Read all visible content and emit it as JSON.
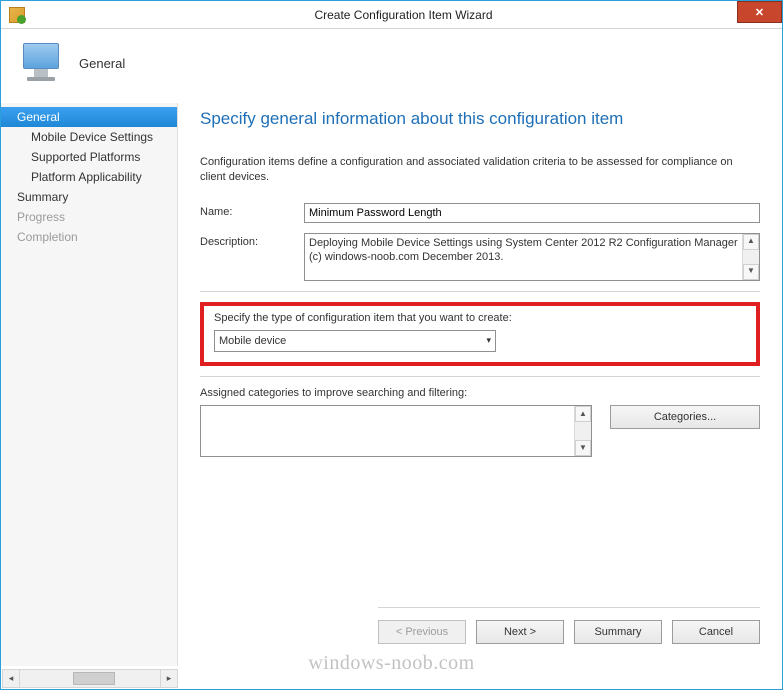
{
  "window": {
    "title": "Create Configuration Item Wizard",
    "close_symbol": "✕"
  },
  "header": {
    "title": "General"
  },
  "sidebar": {
    "items": [
      {
        "label": "General",
        "selected": true,
        "sub": false,
        "disabled": false
      },
      {
        "label": "Mobile Device Settings",
        "selected": false,
        "sub": true,
        "disabled": false
      },
      {
        "label": "Supported Platforms",
        "selected": false,
        "sub": true,
        "disabled": false
      },
      {
        "label": "Platform Applicability",
        "selected": false,
        "sub": true,
        "disabled": false
      },
      {
        "label": "Summary",
        "selected": false,
        "sub": false,
        "disabled": false
      },
      {
        "label": "Progress",
        "selected": false,
        "sub": false,
        "disabled": true
      },
      {
        "label": "Completion",
        "selected": false,
        "sub": false,
        "disabled": true
      }
    ]
  },
  "main": {
    "page_title": "Specify general information about this configuration item",
    "intro": "Configuration items define a configuration and associated validation criteria to be assessed for compliance on client devices.",
    "name_label": "Name:",
    "name_value": "Minimum Password Length",
    "description_label": "Description:",
    "description_value": "Deploying Mobile Device Settings using System Center 2012 R2 Configuration Manager (c) windows-noob.com December 2013.",
    "type_section_label": "Specify the type of configuration item that you want to create:",
    "type_selected": "Mobile device",
    "categories_label": "Assigned categories to improve searching and filtering:",
    "categories_button": "Categories..."
  },
  "footer": {
    "previous": "< Previous",
    "next": "Next >",
    "summary": "Summary",
    "cancel": "Cancel"
  },
  "watermark": "windows-noob.com"
}
